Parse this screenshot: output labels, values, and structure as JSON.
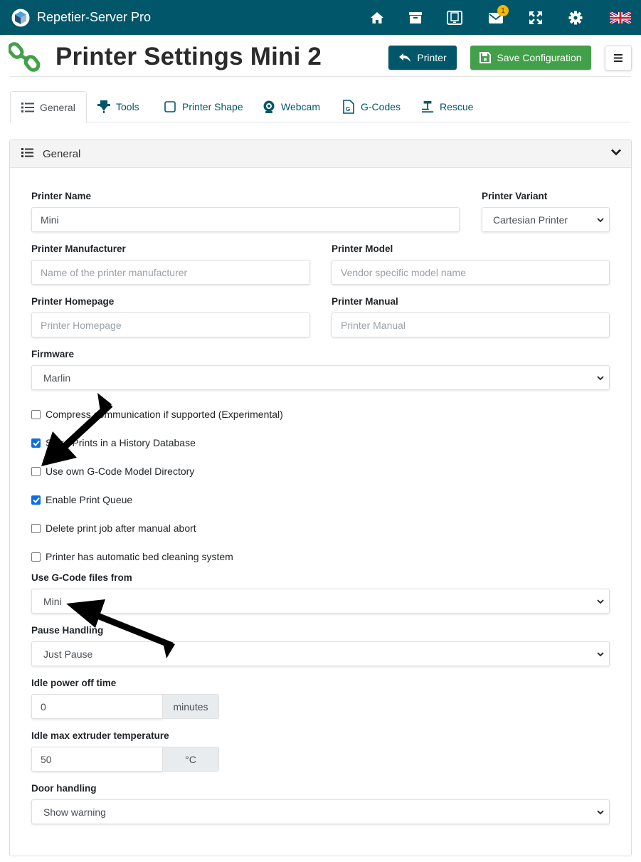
{
  "app": {
    "name": "Repetier-Server Pro",
    "messages_badge": "1",
    "nav_icons": [
      "home-icon",
      "archive-icon",
      "tablet-icon",
      "mail-icon",
      "fullscreen-icon",
      "gear-icon",
      "uk-flag-icon"
    ],
    "colors": {
      "navbar": "#015769",
      "save": "#43a04a",
      "link": "#015769",
      "checkbox": "#0b6fe0"
    }
  },
  "header": {
    "title": "Printer Settings Mini 2",
    "printer_button": "Printer",
    "save_button": "Save Configuration"
  },
  "tabs": [
    {
      "label": "General",
      "icon": "list-icon",
      "active": true
    },
    {
      "label": "Tools",
      "icon": "tools-icon"
    },
    {
      "label": "Printer Shape",
      "icon": "shape-icon"
    },
    {
      "label": "Webcam",
      "icon": "webcam-icon"
    },
    {
      "label": "G-Codes",
      "icon": "gcode-file-icon"
    },
    {
      "label": "Rescue",
      "icon": "rescue-icon"
    }
  ],
  "section": {
    "title": "General"
  },
  "form": {
    "printer_name": {
      "label": "Printer Name",
      "value": "Mini"
    },
    "printer_variant": {
      "label": "Printer Variant",
      "value": "Cartesian Printer"
    },
    "manufacturer": {
      "label": "Printer Manufacturer",
      "placeholder": "Name of the printer manufacturer"
    },
    "model": {
      "label": "Printer Model",
      "placeholder": "Vendor specific model name"
    },
    "homepage": {
      "label": "Printer Homepage",
      "placeholder": "Printer Homepage"
    },
    "manual": {
      "label": "Printer Manual",
      "placeholder": "Printer Manual"
    },
    "firmware": {
      "label": "Firmware",
      "value": "Marlin"
    },
    "checkboxes": [
      {
        "label": "Compress communication if supported (Experimental)",
        "checked": false
      },
      {
        "label": "Store Prints in a History Database",
        "checked": true
      },
      {
        "label": "Use own G-Code Model Directory",
        "checked": false
      },
      {
        "label": "Enable Print Queue",
        "checked": true
      },
      {
        "label": "Delete print job after manual abort",
        "checked": false
      },
      {
        "label": "Printer has automatic bed cleaning system",
        "checked": false
      }
    ],
    "gcode_source": {
      "label": "Use G-Code files from",
      "value": "Mini"
    },
    "pause_handling": {
      "label": "Pause Handling",
      "value": "Just Pause"
    },
    "idle_power_off": {
      "label": "Idle power off time",
      "value": "0",
      "unit": "minutes"
    },
    "idle_max_temp": {
      "label": "Idle max extruder temperature",
      "value": "50",
      "unit": "°C"
    },
    "door_handling": {
      "label": "Door handling",
      "value": "Show warning"
    }
  }
}
